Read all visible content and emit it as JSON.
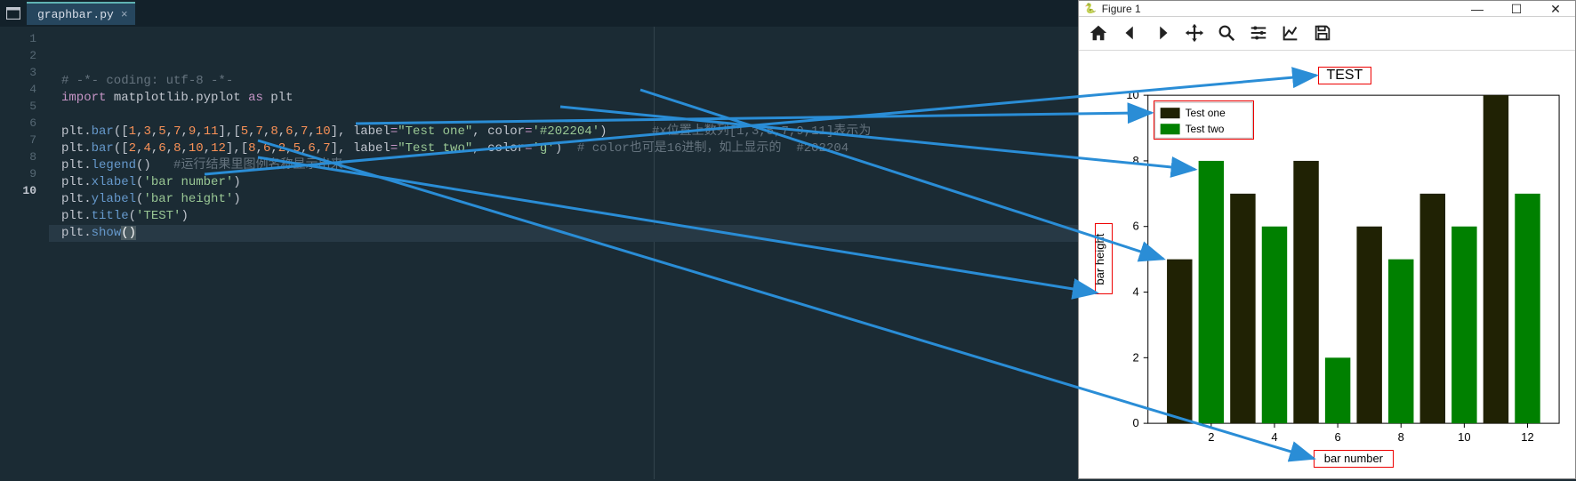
{
  "editor": {
    "tab": {
      "filename": "graphbar.py"
    },
    "lines": [
      {
        "n": 1,
        "segments": [
          {
            "t": "# -*- coding: utf-8 -*-",
            "c": "cmt"
          }
        ]
      },
      {
        "n": 2,
        "segments": [
          {
            "t": "import",
            "c": "kw"
          },
          {
            "t": " matplotlib.pyplot ",
            "c": "plain"
          },
          {
            "t": "as",
            "c": "kw"
          },
          {
            "t": " plt",
            "c": "plain"
          }
        ]
      },
      {
        "n": 3,
        "segments": []
      },
      {
        "n": 4,
        "segments": [
          {
            "t": "plt.",
            "c": "plain"
          },
          {
            "t": "bar",
            "c": "fn"
          },
          {
            "t": "([",
            "c": "plain"
          },
          {
            "t": "1",
            "c": "num"
          },
          {
            "t": ",",
            "c": "plain"
          },
          {
            "t": "3",
            "c": "num"
          },
          {
            "t": ",",
            "c": "plain"
          },
          {
            "t": "5",
            "c": "num"
          },
          {
            "t": ",",
            "c": "plain"
          },
          {
            "t": "7",
            "c": "num"
          },
          {
            "t": ",",
            "c": "plain"
          },
          {
            "t": "9",
            "c": "num"
          },
          {
            "t": ",",
            "c": "plain"
          },
          {
            "t": "11",
            "c": "num"
          },
          {
            "t": "],[",
            "c": "plain"
          },
          {
            "t": "5",
            "c": "num"
          },
          {
            "t": ",",
            "c": "plain"
          },
          {
            "t": "7",
            "c": "num"
          },
          {
            "t": ",",
            "c": "plain"
          },
          {
            "t": "8",
            "c": "num"
          },
          {
            "t": ",",
            "c": "plain"
          },
          {
            "t": "6",
            "c": "num"
          },
          {
            "t": ",",
            "c": "plain"
          },
          {
            "t": "7",
            "c": "num"
          },
          {
            "t": ",",
            "c": "plain"
          },
          {
            "t": "10",
            "c": "num"
          },
          {
            "t": "], ",
            "c": "plain"
          },
          {
            "t": "label",
            "c": "plain"
          },
          {
            "t": "=",
            "c": "op"
          },
          {
            "t": "\"Test one\"",
            "c": "str"
          },
          {
            "t": ", ",
            "c": "plain"
          },
          {
            "t": "color",
            "c": "plain"
          },
          {
            "t": "=",
            "c": "op"
          },
          {
            "t": "'#202204'",
            "c": "str"
          },
          {
            "t": ")",
            "c": "plain"
          },
          {
            "t": "      #x位置上数列[1,3,5,7,9,11]表示为",
            "c": "cmt"
          }
        ]
      },
      {
        "n": 5,
        "segments": [
          {
            "t": "plt.",
            "c": "plain"
          },
          {
            "t": "bar",
            "c": "fn"
          },
          {
            "t": "([",
            "c": "plain"
          },
          {
            "t": "2",
            "c": "num"
          },
          {
            "t": ",",
            "c": "plain"
          },
          {
            "t": "4",
            "c": "num"
          },
          {
            "t": ",",
            "c": "plain"
          },
          {
            "t": "6",
            "c": "num"
          },
          {
            "t": ",",
            "c": "plain"
          },
          {
            "t": "8",
            "c": "num"
          },
          {
            "t": ",",
            "c": "plain"
          },
          {
            "t": "10",
            "c": "num"
          },
          {
            "t": ",",
            "c": "plain"
          },
          {
            "t": "12",
            "c": "num"
          },
          {
            "t": "],[",
            "c": "plain"
          },
          {
            "t": "8",
            "c": "num"
          },
          {
            "t": ",",
            "c": "plain"
          },
          {
            "t": "6",
            "c": "num"
          },
          {
            "t": ",",
            "c": "plain"
          },
          {
            "t": "2",
            "c": "num"
          },
          {
            "t": ",",
            "c": "plain"
          },
          {
            "t": "5",
            "c": "num"
          },
          {
            "t": ",",
            "c": "plain"
          },
          {
            "t": "6",
            "c": "num"
          },
          {
            "t": ",",
            "c": "plain"
          },
          {
            "t": "7",
            "c": "num"
          },
          {
            "t": "], ",
            "c": "plain"
          },
          {
            "t": "label",
            "c": "plain"
          },
          {
            "t": "=",
            "c": "op"
          },
          {
            "t": "\"Test two\"",
            "c": "str"
          },
          {
            "t": ", ",
            "c": "plain"
          },
          {
            "t": "color",
            "c": "plain"
          },
          {
            "t": "=",
            "c": "op"
          },
          {
            "t": "'g'",
            "c": "str"
          },
          {
            "t": ")",
            "c": "plain"
          },
          {
            "t": "  # color也可是16进制，如上显示的  #202204",
            "c": "cmt"
          }
        ]
      },
      {
        "n": 6,
        "segments": [
          {
            "t": "plt.",
            "c": "plain"
          },
          {
            "t": "legend",
            "c": "fn"
          },
          {
            "t": "()",
            "c": "plain"
          },
          {
            "t": "   #运行结果里图例名称显示出来",
            "c": "cmt"
          }
        ]
      },
      {
        "n": 7,
        "segments": [
          {
            "t": "plt.",
            "c": "plain"
          },
          {
            "t": "xlabel",
            "c": "fn"
          },
          {
            "t": "(",
            "c": "plain"
          },
          {
            "t": "'bar number'",
            "c": "str"
          },
          {
            "t": ")",
            "c": "plain"
          }
        ]
      },
      {
        "n": 8,
        "segments": [
          {
            "t": "plt.",
            "c": "plain"
          },
          {
            "t": "ylabel",
            "c": "fn"
          },
          {
            "t": "(",
            "c": "plain"
          },
          {
            "t": "'bar height'",
            "c": "str"
          },
          {
            "t": ")",
            "c": "plain"
          }
        ]
      },
      {
        "n": 9,
        "segments": [
          {
            "t": "plt.",
            "c": "plain"
          },
          {
            "t": "title",
            "c": "fn"
          },
          {
            "t": "(",
            "c": "plain"
          },
          {
            "t": "'TEST'",
            "c": "str"
          },
          {
            "t": ")",
            "c": "plain"
          }
        ]
      },
      {
        "n": 10,
        "current": true,
        "segments": [
          {
            "t": "plt.",
            "c": "plain"
          },
          {
            "t": "show",
            "c": "fn"
          },
          {
            "t": "(",
            "c": "cursor-paren"
          },
          {
            "t": ")",
            "c": "cursor-paren"
          }
        ]
      }
    ]
  },
  "mpl": {
    "window_title": "Figure 1",
    "toolbar": {
      "home": "⌂",
      "back": "←",
      "forward": "→",
      "pan": "✥",
      "zoom": "🔍",
      "configure": "⚙",
      "axes": "📈",
      "save": "💾"
    }
  },
  "chart_data": {
    "type": "bar",
    "title": "TEST",
    "xlabel": "bar number",
    "ylabel": "bar height",
    "xlim": [
      0,
      13
    ],
    "ylim": [
      0,
      10
    ],
    "xticks": [
      2,
      4,
      6,
      8,
      10,
      12
    ],
    "yticks": [
      0,
      2,
      4,
      6,
      8,
      10
    ],
    "legend_position": "upper left",
    "series": [
      {
        "name": "Test one",
        "color": "#202204",
        "x": [
          1,
          3,
          5,
          7,
          9,
          11
        ],
        "values": [
          5,
          7,
          8,
          6,
          7,
          10
        ]
      },
      {
        "name": "Test two",
        "color": "#008000",
        "x": [
          2,
          4,
          6,
          8,
          10,
          12
        ],
        "values": [
          8,
          6,
          2,
          5,
          6,
          7
        ]
      }
    ]
  },
  "annotations": {
    "legend_box": true,
    "ylabel_box": true,
    "xlabel_box": true,
    "title_box": true
  }
}
